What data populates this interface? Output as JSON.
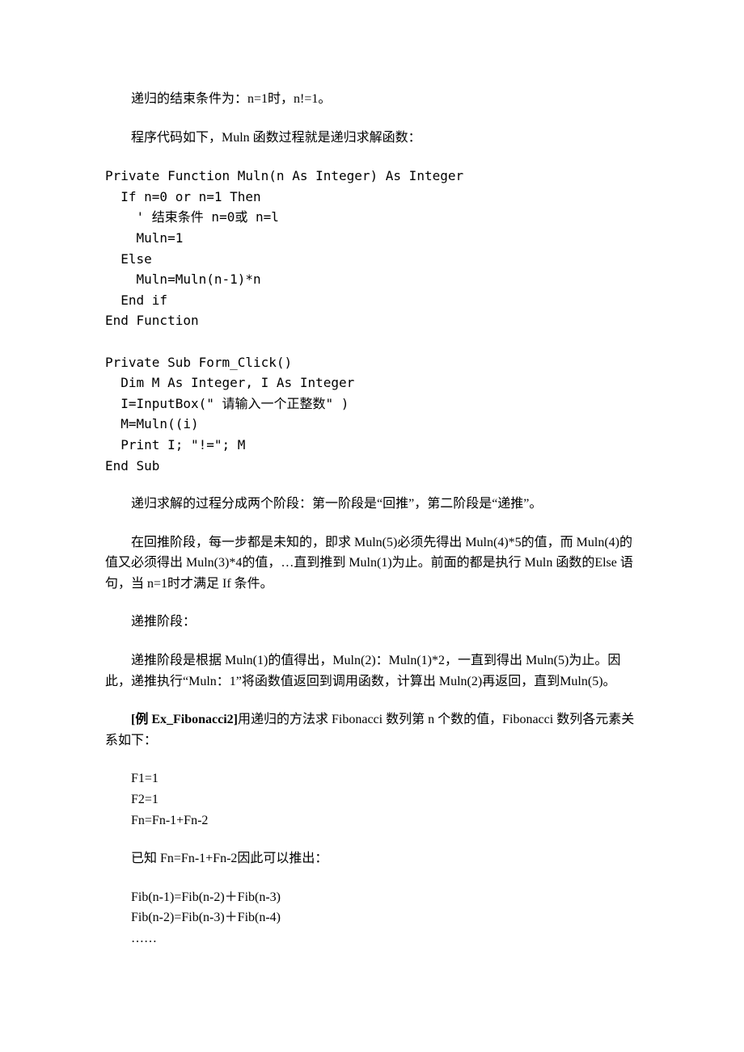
{
  "p1": "递归的结束条件为：n=1时，n!=1。",
  "p2": "程序代码如下，Muln 函数过程就是递归求解函数：",
  "code1": "Private Function Muln(n As Integer) As Integer\n  If n=0 or n=1 Then\n    ' 结束条件 n=0或 n=l\n    Muln=1\n  Else\n    Muln=Muln(n-1)*n\n  End if\nEnd Function\n\nPrivate Sub Form_Click()\n  Dim M As Integer, I As Integer\n  I=InputBox(\" 请输入一个正整数\" )\n  M=Muln((i)\n  Print I; \"!=\"; M\nEnd Sub",
  "p3": "递归求解的过程分成两个阶段：第一阶段是“回推”，第二阶段是“递推”。",
  "p4": "在回推阶段，每一步都是未知的，即求 Muln(5)必须先得出 Muln(4)*5的值，而 Muln(4)的值又必须得出 Muln(3)*4的值，…直到推到 Muln(1)为止。前面的都是执行 Muln 函数的Else 语句，当 n=1时才满足 If 条件。",
  "p5": "递推阶段：",
  "p6": "递推阶段是根据 Muln(1)的值得出，Muln(2)：Muln(1)*2，一直到得出 Muln(5)为止。因此，递推执行“Muln：1”将函数值返回到调用函数，计算出 Muln(2)再返回，直到Muln(5)。",
  "p7_bold": "[例 Ex_Fibonacci2]",
  "p7_rest": "用递归的方法求 Fibonacci 数列第 n 个数的值，Fibonacci 数列各元素关系如下：",
  "eq1": "F1=1\nF2=1\nFn=Fn-1+Fn-2",
  "p8": "已知 Fn=Fn-1+Fn-2因此可以推出：",
  "eq2": "Fib(n-1)=Fib(n-2)＋Fib(n-3)\nFib(n-2)=Fib(n-3)＋Fib(n-4)\n……"
}
